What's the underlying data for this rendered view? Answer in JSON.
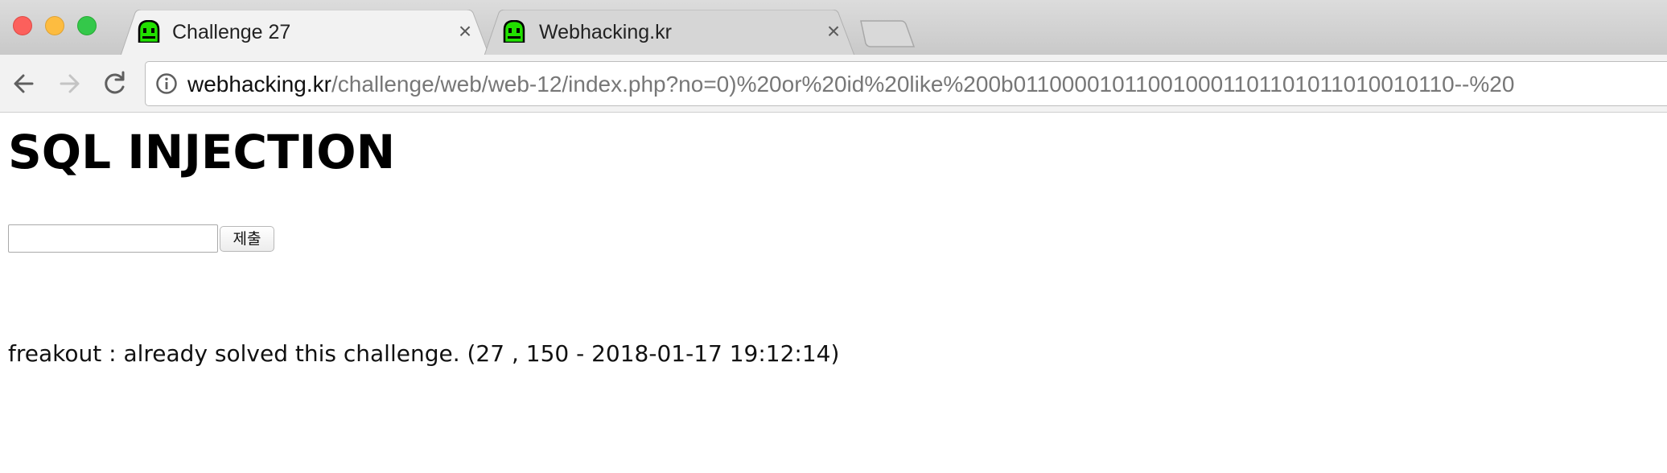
{
  "browser": {
    "tabs": [
      {
        "title": "Challenge 27",
        "active": true,
        "favicon": "green-ghost-icon"
      },
      {
        "title": "Webhacking.kr",
        "active": false,
        "favicon": "green-ghost-icon"
      }
    ],
    "tab_close_glyph": "×",
    "address_bar": {
      "host": "webhacking.kr",
      "path": "/challenge/web/web-12/index.php?no=0)%20or%20id%20like%200b011000010110010001101101011010010110--%20"
    },
    "icons": {
      "back": "back-arrow-icon",
      "forward": "forward-arrow-icon",
      "reload": "reload-icon",
      "info": "info-icon"
    }
  },
  "page": {
    "title": "SQL INJECTION",
    "form": {
      "input_value": "",
      "submit_label": "제출"
    },
    "status": "freakout : already solved this challenge. (27 , 150 - 2018-01-17 19:12:14)"
  },
  "colors": {
    "traffic_close": "#fc605c",
    "traffic_min": "#fdbc40",
    "traffic_max": "#34c84a",
    "favicon_green": "#22e000"
  }
}
